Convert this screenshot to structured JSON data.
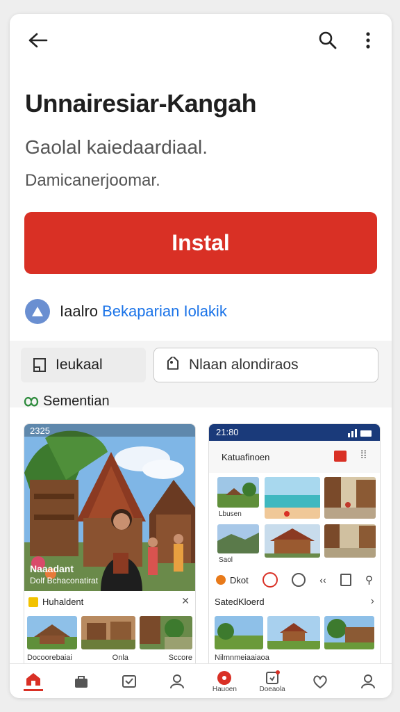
{
  "app": {
    "title": "Unnairesiar-Kangah",
    "subtitle": "Gaolal kaiedaardiaal.",
    "subtitle2": "Damicanerjoomar.",
    "install_label": "Instal"
  },
  "info": {
    "text": "Iaalro",
    "link": "Bekaparian Iolakik"
  },
  "chips": {
    "chip1_label": "Ieukaal",
    "chip2_label": "Nlaan alondiraos"
  },
  "section": {
    "label": "Sementian"
  },
  "shot1": {
    "status_time": "2325",
    "overlay_title": "Naaadant",
    "overlay_sub": "Dolf Bchaconatirat",
    "panel_title": "Huhaldent",
    "thumb_labels": [
      "Docoorebaiai",
      "Onla",
      "Sccore"
    ]
  },
  "shot2": {
    "status_time": "21:80",
    "app_title": "Katuafinoen",
    "tile_labels": [
      "Lbusen",
      "Saol"
    ],
    "action_label": "Dkot",
    "panel_title": "SatedKloerd",
    "bottom_caption": "Nilmnmeiaaiaoa"
  },
  "bottom_nav": {
    "labels": [
      "Hauoen",
      "Doeaola"
    ]
  },
  "colors": {
    "accent": "#d93025",
    "link": "#1a73e8",
    "status_bar_blue": "#1a3a7a"
  }
}
